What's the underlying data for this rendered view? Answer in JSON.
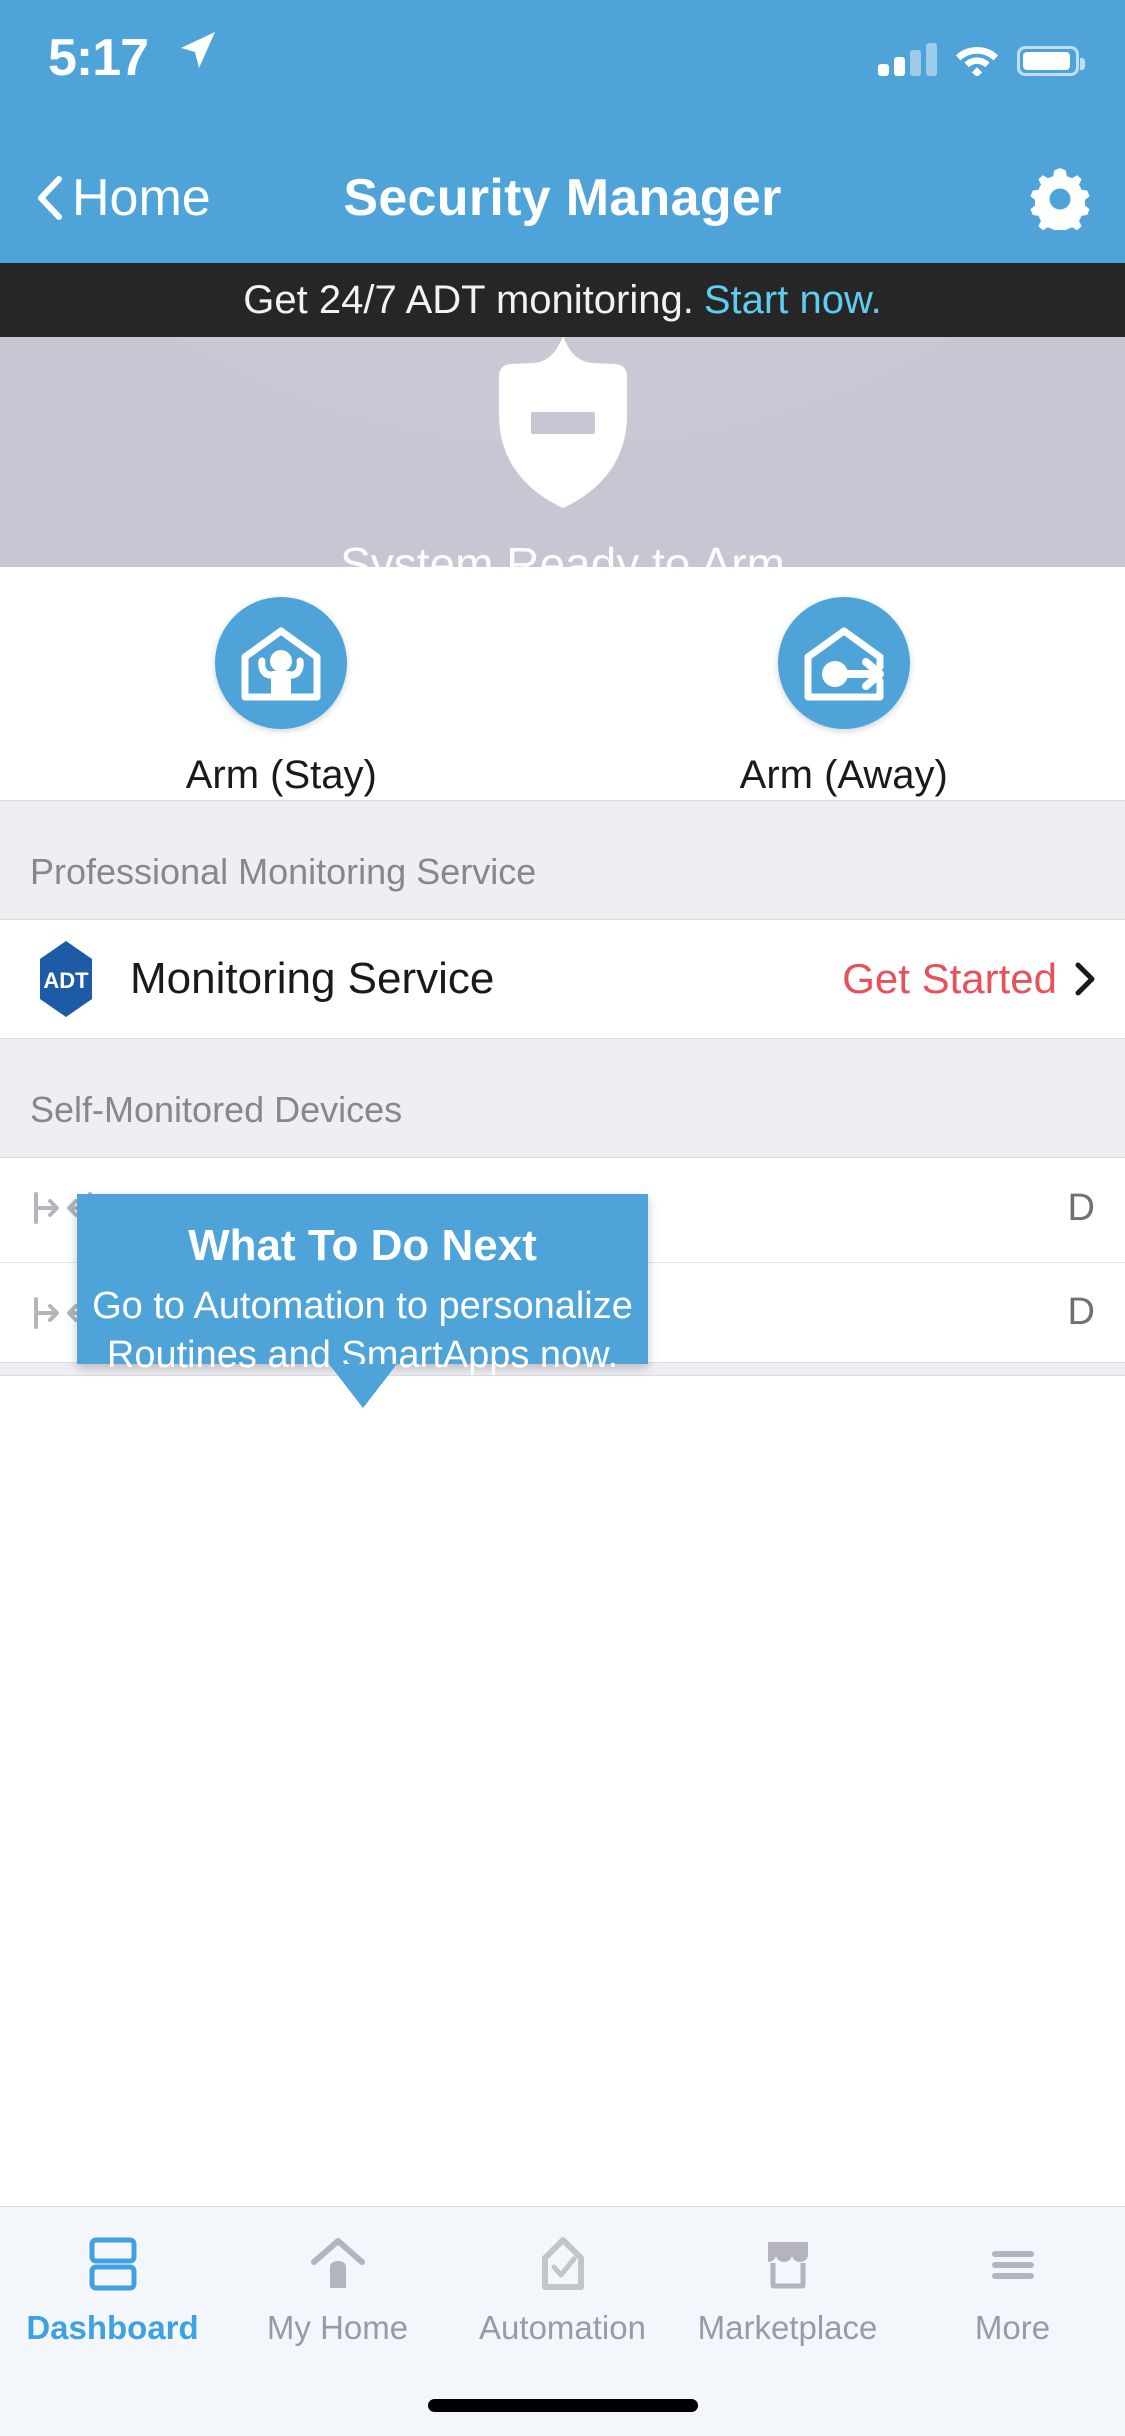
{
  "status_bar": {
    "time": "5:17",
    "location_icon": "location-arrow-icon",
    "signal_icon": "cellular-signal-icon",
    "wifi_icon": "wifi-icon",
    "battery_icon": "battery-icon"
  },
  "nav": {
    "back_label": "Home",
    "back_icon": "chevron-left-icon",
    "title": "Security Manager",
    "settings_icon": "gear-icon"
  },
  "promo": {
    "text": "Get 24/7 ADT monitoring.",
    "link": "Start now."
  },
  "hero": {
    "shield_icon": "shield-disarmed-icon",
    "status": "System Ready to Arm",
    "background_color": "#c6c7d3"
  },
  "arm_actions": [
    {
      "label": "Arm (Stay)",
      "icon": "house-person-icon"
    },
    {
      "label": "Arm (Away)",
      "icon": "house-exit-arrow-icon"
    }
  ],
  "sections": {
    "professional": {
      "header": "Professional Monitoring Service",
      "row": {
        "logo": "adt-logo-icon",
        "logo_text": "ADT",
        "title": "Monitoring Service",
        "action": "Get Started",
        "action_color": "#e8505b",
        "chevron_icon": "chevron-right-icon"
      }
    },
    "self_monitored": {
      "header": "Self-Monitored Devices",
      "devices": [
        {
          "icon": "contact-sensor-icon",
          "name": "",
          "state": "D"
        },
        {
          "icon": "contact-sensor-icon",
          "name": "",
          "state": "D"
        }
      ]
    }
  },
  "tooltip": {
    "title": "What To Do Next",
    "line1": "Go to Automation to personalize",
    "line2": "Routines and SmartApps now.",
    "background_color": "#4ea3d8"
  },
  "tab_bar": {
    "accent_color": "#3fa1e0",
    "items": [
      {
        "label": "Dashboard",
        "icon": "dashboard-icon",
        "active": true
      },
      {
        "label": "My Home",
        "icon": "home-icon",
        "active": false
      },
      {
        "label": "Automation",
        "icon": "automation-icon",
        "active": false
      },
      {
        "label": "Marketplace",
        "icon": "marketplace-icon",
        "active": false
      },
      {
        "label": "More",
        "icon": "more-menu-icon",
        "active": false
      }
    ]
  },
  "theme": {
    "brand_blue": "#4ea3d8",
    "banner_dark": "#262626",
    "banner_link": "#5ecdf0"
  }
}
